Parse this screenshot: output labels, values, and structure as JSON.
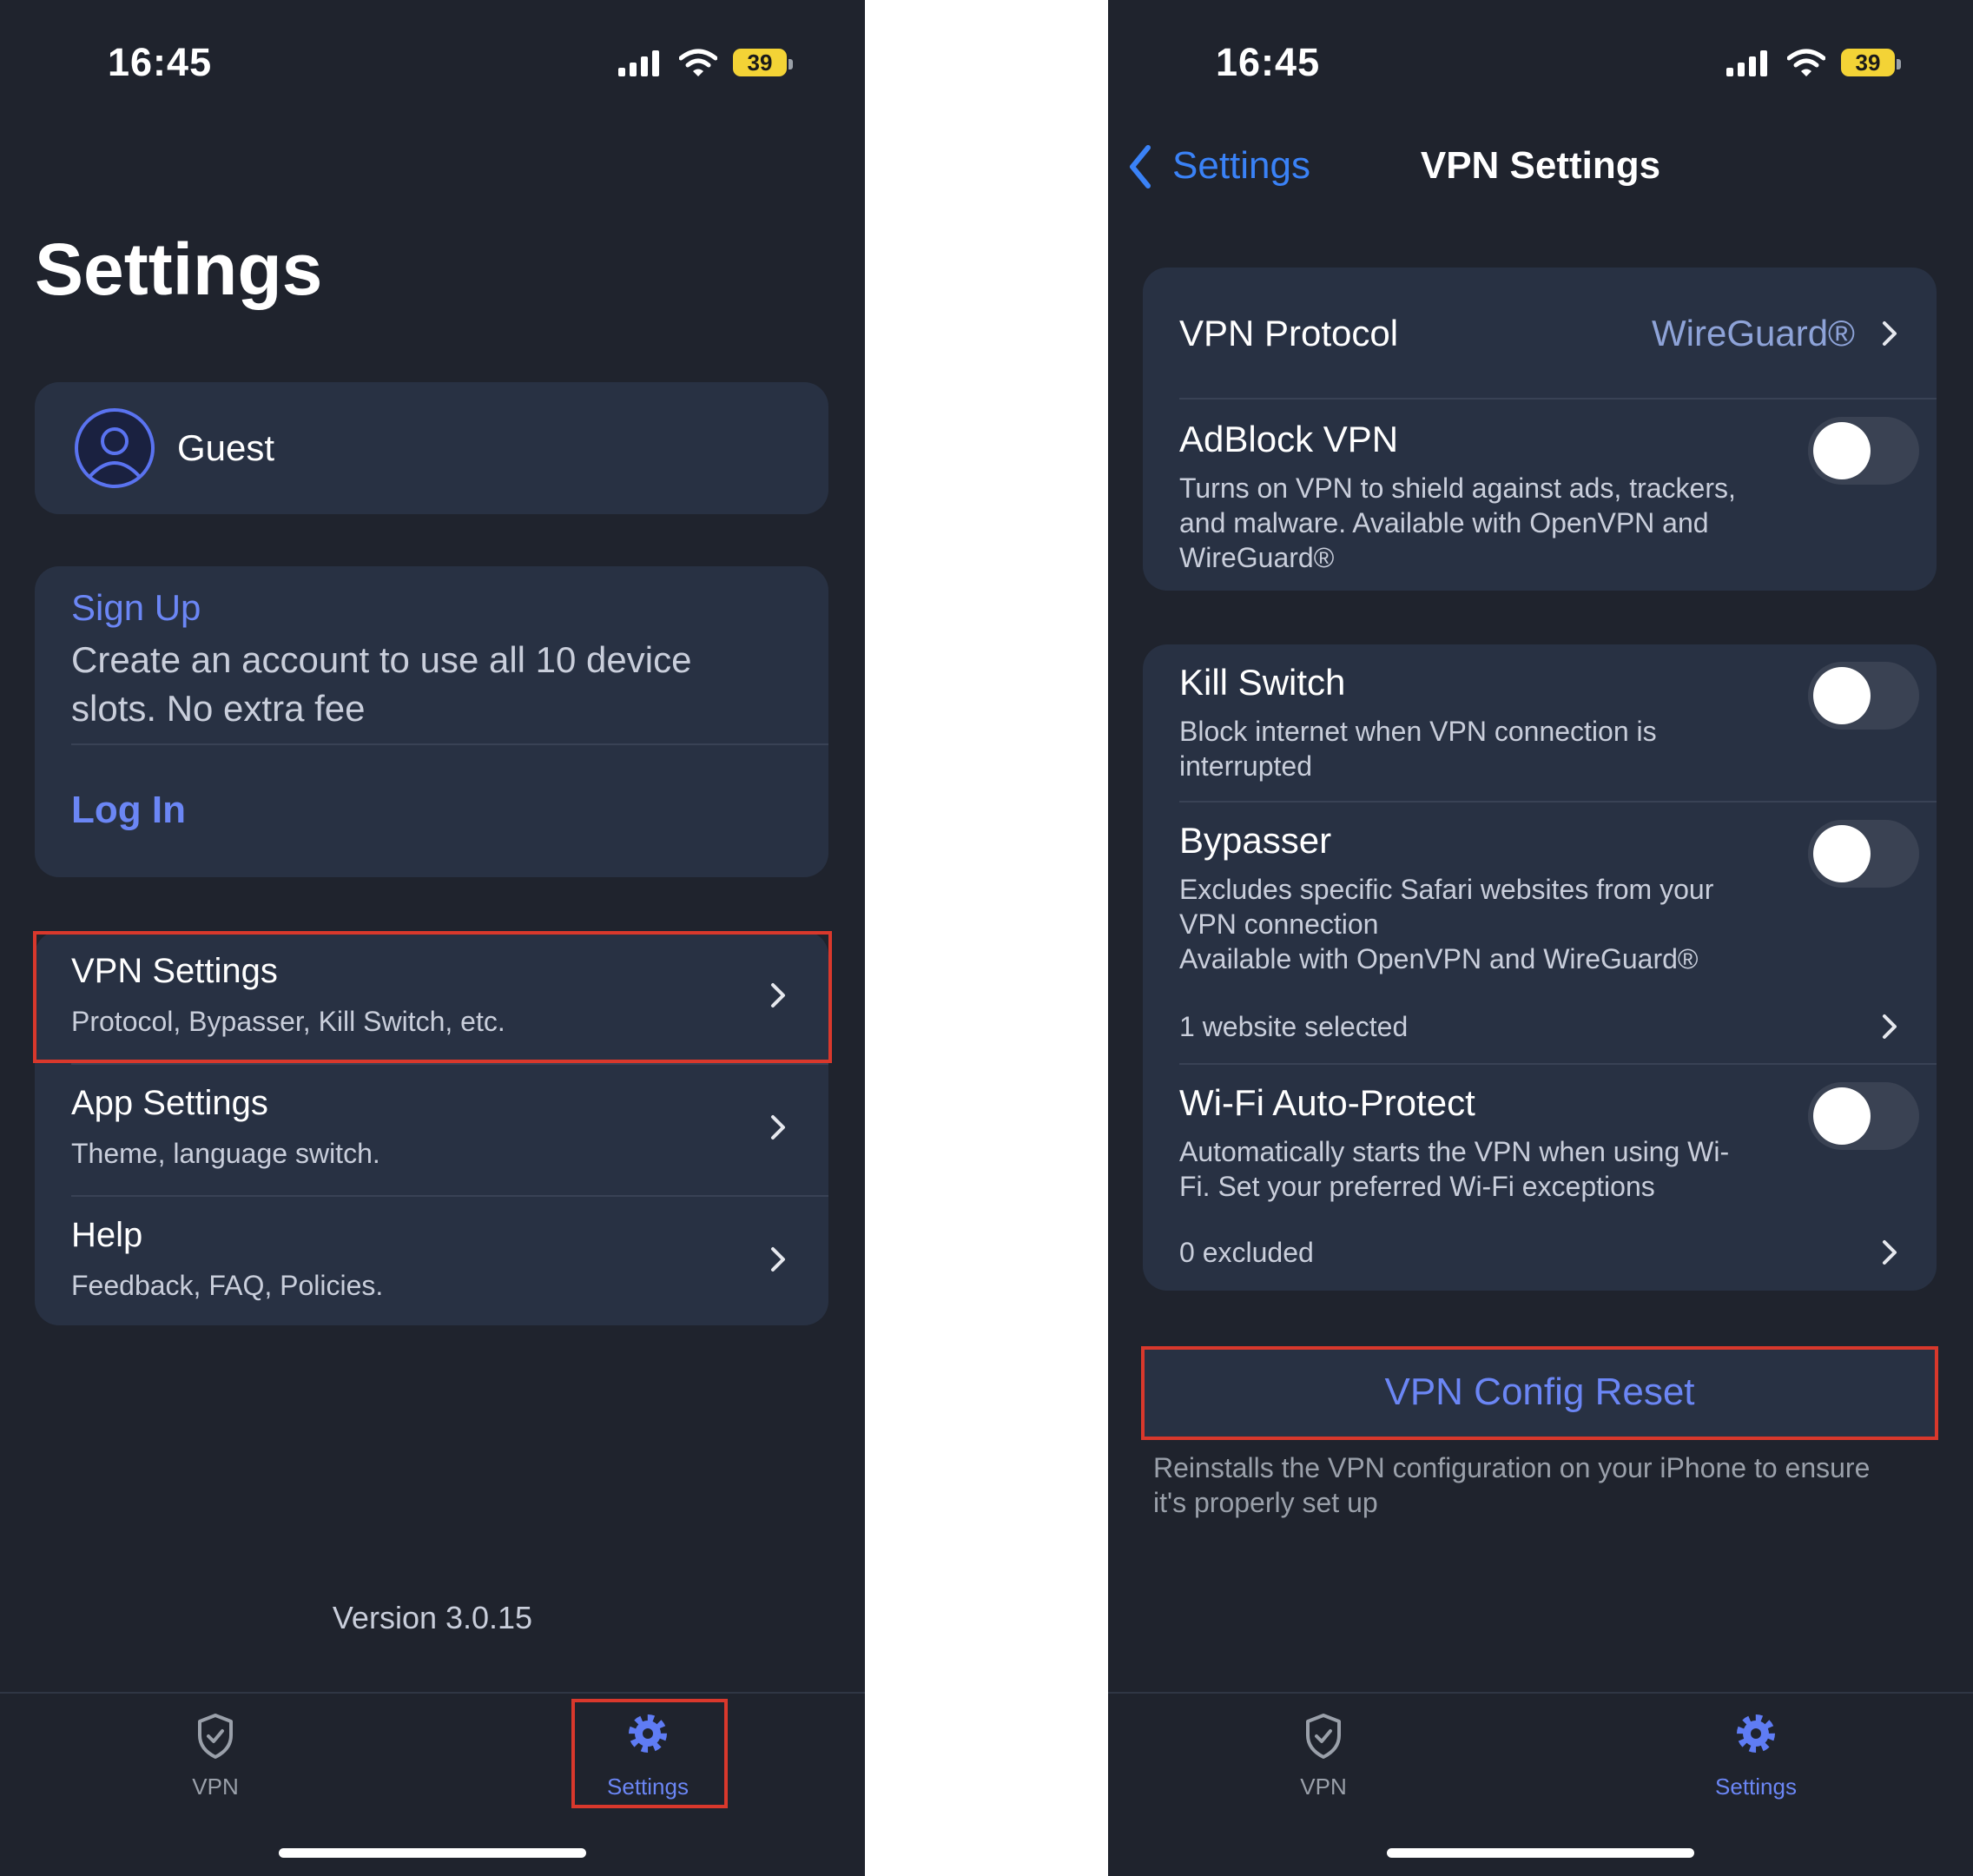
{
  "status": {
    "time": "16:45",
    "battery": "39"
  },
  "left": {
    "page_title": "Settings",
    "profile": {
      "name": "Guest"
    },
    "signup": {
      "link": "Sign Up",
      "text_line1": "Create an account to use all 10 device",
      "text_line2": "slots. No extra fee",
      "login": "Log In"
    },
    "menu": [
      {
        "title": "VPN Settings",
        "subtitle": "Protocol, Bypasser, Kill Switch, etc."
      },
      {
        "title": "App Settings",
        "subtitle": "Theme, language switch."
      },
      {
        "title": "Help",
        "subtitle": "Feedback, FAQ, Policies."
      }
    ],
    "version": "Version 3.0.15"
  },
  "right": {
    "nav": {
      "back": "Settings",
      "title": "VPN Settings"
    },
    "protocol": {
      "label": "VPN Protocol",
      "value": "WireGuard®"
    },
    "adblock": {
      "title": "AdBlock VPN",
      "desc": [
        "Turns on VPN to shield against ads, trackers,",
        "and malware. Available with OpenVPN and",
        "WireGuard®"
      ],
      "enabled": false
    },
    "killswitch": {
      "title": "Kill Switch",
      "desc": [
        "Block internet when VPN connection is",
        "interrupted"
      ],
      "enabled": false
    },
    "bypasser": {
      "title": "Bypasser",
      "desc": [
        "Excludes specific Safari websites from your",
        "VPN connection",
        "Available with OpenVPN and WireGuard®"
      ],
      "detail": "1 website selected",
      "enabled": false
    },
    "wifi": {
      "title": "Wi-Fi Auto-Protect",
      "desc": [
        "Automatically starts the VPN when using Wi-",
        "Fi. Set your preferred Wi-Fi exceptions"
      ],
      "detail": "0 excluded",
      "enabled": false
    },
    "reset": {
      "button": "VPN Config Reset",
      "desc": [
        "Reinstalls the VPN configuration on your iPhone to ensure",
        "it's properly set up"
      ]
    }
  },
  "tabs": [
    {
      "label": "VPN",
      "icon": "shield-check-icon",
      "active": false
    },
    {
      "label": "Settings",
      "icon": "gear-icon",
      "active": true
    }
  ],
  "colors": {
    "background": "#1f232d",
    "card": "#283143",
    "accent_blue": "#6b86f5",
    "ios_blue": "#3a82f7",
    "highlight": "#d9382c"
  }
}
